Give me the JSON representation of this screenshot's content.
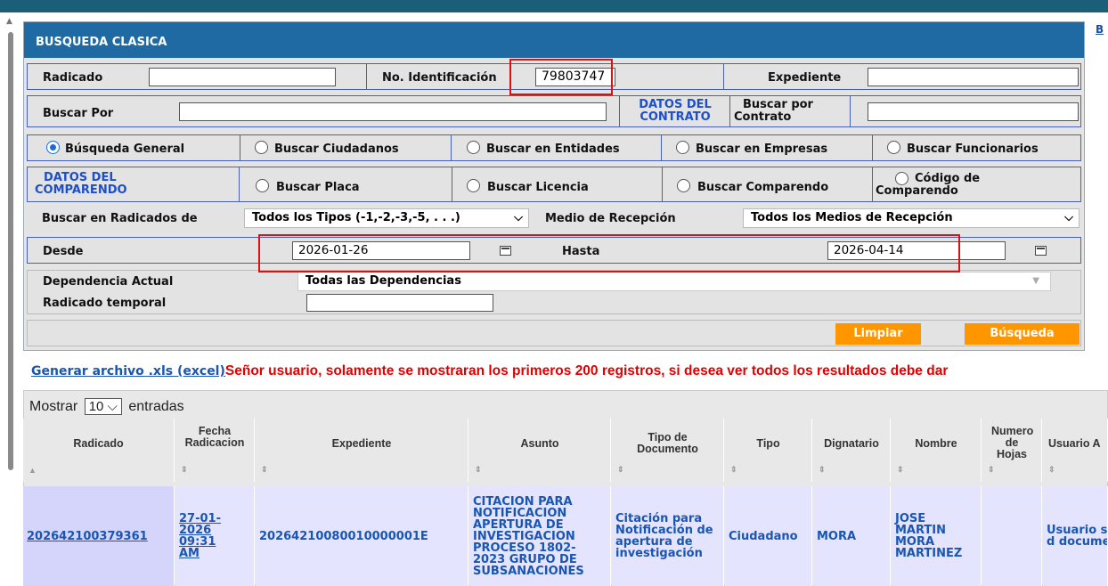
{
  "panel_title": "BUSQUEDA CLASICA",
  "edge_link": "B",
  "row1": {
    "radicado_label": "Radicado",
    "radicado_value": "",
    "identificacion_label": "No. Identificación",
    "identificacion_value": "79803747",
    "expediente_label": "Expediente",
    "expediente_value": ""
  },
  "row2": {
    "buscar_por_label": "Buscar Por",
    "buscar_por_value": "",
    "datos_contrato_l1": "DATOS DEL",
    "datos_contrato_l2": "CONTRATO",
    "buscar_contrato_l1": "Buscar por",
    "buscar_contrato_l2": "Contrato",
    "contrato_value": ""
  },
  "search_types": [
    {
      "label": "Búsqueda General",
      "checked": true
    },
    {
      "label": "Buscar Ciudadanos",
      "checked": false
    },
    {
      "label": "Buscar en Entidades",
      "checked": false
    },
    {
      "label": "Buscar en Empresas",
      "checked": false
    },
    {
      "label": "Buscar Funcionarios",
      "checked": false
    }
  ],
  "comparendo": {
    "title_l1": "DATOS DEL",
    "title_l2": "COMPARENDO",
    "options": [
      "Buscar Placa",
      "Buscar Licencia",
      "Buscar Comparendo"
    ],
    "codigo_l1": "Código de",
    "codigo_l2": "Comparendo"
  },
  "filters": {
    "radicados_label": "Buscar en Radicados de",
    "radicados_value": "Todos los Tipos (-1,-2,-3,-5, . . .)",
    "medio_label": "Medio de Recepción",
    "medio_value": "Todos los Medios de Recepción"
  },
  "dates": {
    "desde_label": "Desde",
    "desde_value": "2026-01-26",
    "hasta_label": "Hasta",
    "hasta_value": "2026-04-14"
  },
  "dependencia": {
    "label": "Dependencia Actual",
    "value": "Todas las Dependencias",
    "temporal_label": "Radicado temporal",
    "temporal_value": ""
  },
  "buttons": {
    "limpiar": "Limpiar",
    "busqueda": "Búsqueda"
  },
  "notice": {
    "xls_link": "Generar archivo .xls (excel)",
    "warning": "Señor usuario, solamente se mostraran los primeros 200 registros, si desea ver todos los resultados debe dar"
  },
  "table": {
    "show_prefix": "Mostrar",
    "show_value": "10",
    "show_suffix": "entradas",
    "headers": [
      "Radicado",
      "Fecha Radicacion",
      "Expediente",
      "Asunto",
      "Tipo de Documento",
      "Tipo",
      "Dignatario",
      "Nombre",
      "Numero de Hojas",
      "Usuario A"
    ],
    "row": {
      "radicado": "202642100379361",
      "fecha": "27-01-2026 09:31 AM",
      "expediente": "20264210080010000001E",
      "asunto": "CITACION PARA NOTIFICACION APERTURA DE INVESTIGACION PROCESO 1802-2023 GRUPO DE SUBSANACIONES",
      "tipo_documento": "Citación para Notificación de apertura de investigación",
      "tipo": "Ciudadano",
      "dignatario": "MORA",
      "nombre": "JOSE MARTIN MORA MARTINEZ",
      "hojas": "",
      "usuario": "Usuario salida d docume"
    }
  },
  "colors": {
    "header_blue": "#1f6aa3",
    "button_orange": "#ff9600",
    "warning_red": "#e00000",
    "highlight_red": "#e01010",
    "row_bg": "#e4e4ff"
  }
}
